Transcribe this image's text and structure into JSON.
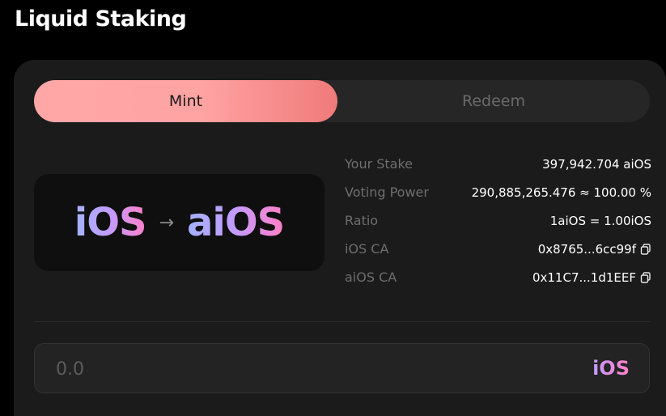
{
  "page": {
    "title": "Liquid Staking"
  },
  "tabs": [
    {
      "label": "Mint",
      "active": true
    },
    {
      "label": "Redeem",
      "active": false
    }
  ],
  "logo": {
    "from": "iOS",
    "arrow": "→",
    "to": "aiOS"
  },
  "stats": [
    {
      "label": "Your Stake",
      "value": "397,942.704 aiOS",
      "copy": false
    },
    {
      "label": "Voting Power",
      "value": "290,885,265.476 ≈ 100.00 %",
      "copy": false
    },
    {
      "label": "Ratio",
      "value": "1aiOS = 1.00iOS",
      "copy": false
    },
    {
      "label": "iOS CA",
      "value": "0x8765...6cc99f",
      "copy": true
    },
    {
      "label": "aiOS CA",
      "value": "0x11C7...1d1EEF",
      "copy": true
    }
  ],
  "amount": {
    "placeholder": "0.0",
    "value": "",
    "token": "iOS"
  },
  "colors": {
    "accent_start": "#ffa7a7",
    "accent_end": "#f07a7a",
    "background": "#000000",
    "card": "#1b1b1b"
  },
  "icons": {
    "copy": "copy-icon"
  }
}
